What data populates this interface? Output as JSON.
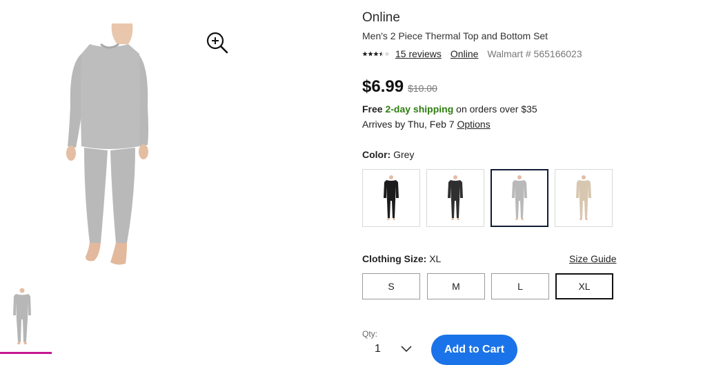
{
  "product": {
    "brand": "Online",
    "title": "Men's 2 Piece Thermal Top and Bottom Set",
    "rating": 3.5,
    "reviews_label": "15 reviews",
    "seller_link": "Online",
    "walmart_number": "Walmart # 565166023"
  },
  "price": {
    "current": "$6.99",
    "was": "$10.00"
  },
  "shipping": {
    "free_label": "Free",
    "two_day": "2-day shipping",
    "condition": "on orders over $35",
    "arrives": "Arrives by Thu, Feb 7",
    "options_link": "Options"
  },
  "color": {
    "label": "Color:",
    "selected": "Grey",
    "swatches": [
      {
        "name": "Black",
        "color": "#1c1c1c"
      },
      {
        "name": "Charcoal",
        "color": "#2f2f2f"
      },
      {
        "name": "Grey",
        "color": "#b9b9b9"
      },
      {
        "name": "Oatmeal",
        "color": "#d8c7b0"
      }
    ]
  },
  "size": {
    "label": "Clothing Size:",
    "selected": "XL",
    "guide_link": "Size Guide",
    "options": [
      "S",
      "M",
      "L",
      "XL"
    ]
  },
  "cart": {
    "qty_label": "Qty:",
    "qty_value": "1",
    "add_button": "Add to Cart"
  },
  "accent_colors": {
    "thumb_underline": "#c6168d",
    "shipping_green": "#2e7d0f",
    "button_blue": "#1a73e8"
  }
}
